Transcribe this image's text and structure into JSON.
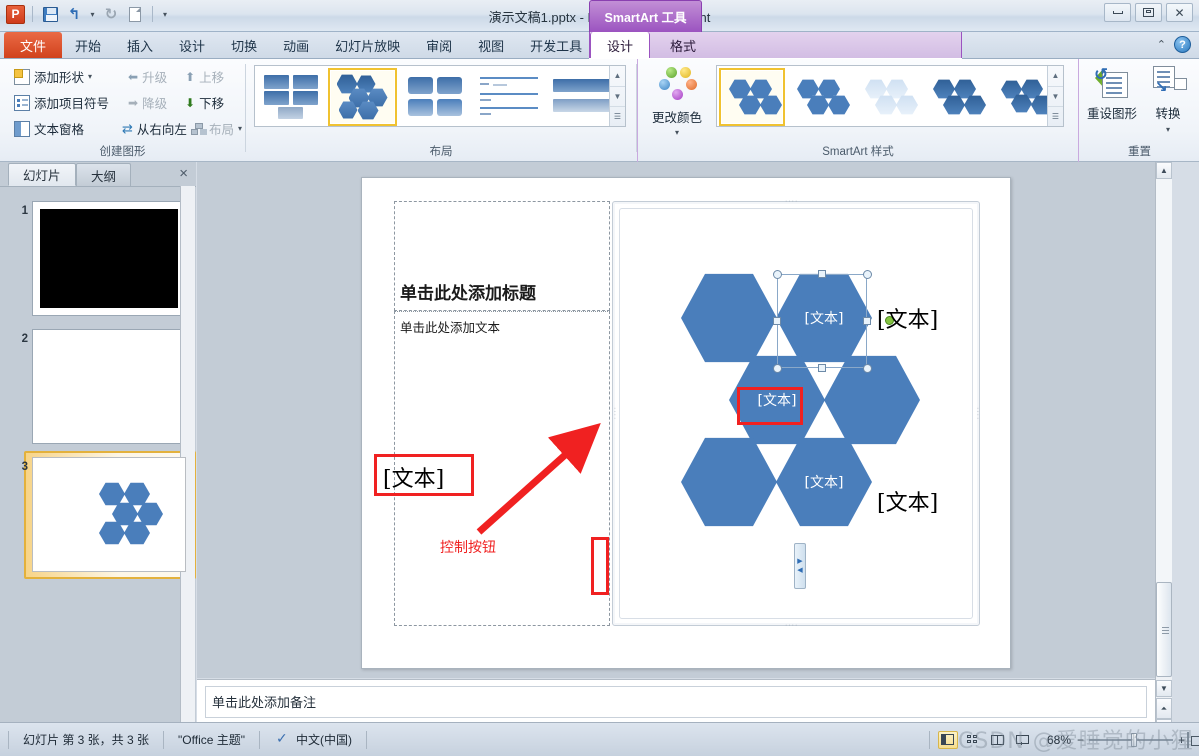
{
  "window": {
    "title": "演示文稿1.pptx  -  Microsoft PowerPoint",
    "minimize": "最小化",
    "restore": "向下还原",
    "close": "关闭"
  },
  "quick_access": {
    "logo": "P",
    "save": "保存",
    "undo": "撤消",
    "redo": "重复",
    "new": "新建",
    "customize": "自定义快速访问工具栏"
  },
  "tabs": [
    {
      "label": "文件",
      "type": "file"
    },
    {
      "label": "开始"
    },
    {
      "label": "插入"
    },
    {
      "label": "设计"
    },
    {
      "label": "切换"
    },
    {
      "label": "动画"
    },
    {
      "label": "幻灯片放映"
    },
    {
      "label": "审阅"
    },
    {
      "label": "视图"
    },
    {
      "label": "开发工具"
    }
  ],
  "contextual": {
    "banner": "SmartArt 工具",
    "tabs": [
      {
        "label": "设计",
        "selected": true
      },
      {
        "label": "格式",
        "selected": false
      }
    ]
  },
  "ribbon": {
    "groups": [
      {
        "name": "创建图形",
        "items": [
          {
            "label": "添加形状",
            "dropdown": true,
            "enabled": true
          },
          {
            "label": "升级",
            "enabled": false
          },
          {
            "label": "上移",
            "enabled": false
          },
          {
            "label": "添加项目符号",
            "enabled": true
          },
          {
            "label": "降级",
            "enabled": false
          },
          {
            "label": "下移",
            "enabled": true
          },
          {
            "label": "文本窗格",
            "enabled": true
          },
          {
            "label": "从右向左",
            "enabled": true
          },
          {
            "label": "布局",
            "dropdown": true,
            "enabled": false
          }
        ]
      },
      {
        "name": "布局"
      },
      {
        "name": "SmartArt 样式",
        "change_colors": "更改颜色"
      },
      {
        "name": "重置",
        "items": [
          {
            "label": "重设图形"
          },
          {
            "label": "转换"
          }
        ]
      }
    ],
    "layout_gallery": [
      {
        "name": "layout-thumb-blocks",
        "selected": false
      },
      {
        "name": "layout-thumb-hexagon",
        "selected": true
      },
      {
        "name": "layout-thumb-rounded",
        "selected": false
      },
      {
        "name": "layout-thumb-lines",
        "selected": false
      },
      {
        "name": "layout-thumb-bars",
        "selected": false
      }
    ],
    "style_gallery": [
      {
        "name": "style-thumb-simple-fill",
        "selected": true
      },
      {
        "name": "style-thumb-white-outline",
        "selected": false
      },
      {
        "name": "style-thumb-subtle-effect",
        "selected": false
      },
      {
        "name": "style-thumb-moderate-effect",
        "selected": false
      },
      {
        "name": "style-thumb-intense-effect",
        "selected": false
      }
    ],
    "scroll": {
      "up": "▲",
      "down": "▼",
      "more": "▼"
    }
  },
  "slides_panel": {
    "tabs": [
      {
        "label": "幻灯片",
        "selected": true
      },
      {
        "label": "大纲",
        "selected": false
      }
    ],
    "close": "×",
    "slides": [
      {
        "number": "1",
        "selected": false,
        "content": "black"
      },
      {
        "number": "2",
        "selected": false,
        "content": "blank"
      },
      {
        "number": "3",
        "selected": true,
        "content": "hexagons"
      }
    ]
  },
  "slide": {
    "title_placeholder": "单击此处添加标题",
    "body_placeholder": "单击此处添加文本",
    "smartart": {
      "hexagons": [
        {
          "id": "hex-top-left",
          "label": ""
        },
        {
          "id": "hex-top-middle",
          "label": "[文本]",
          "selected": true
        },
        {
          "id": "hex-mid-left",
          "label": "[文本]",
          "highlighted": true
        },
        {
          "id": "hex-mid-right",
          "label": ""
        },
        {
          "id": "hex-bottom-left",
          "label": ""
        },
        {
          "id": "hex-bottom-middle",
          "label": "[文本]"
        }
      ],
      "outside_labels": [
        {
          "id": "outside-label-left",
          "text": "[文本]",
          "highlighted": true
        },
        {
          "id": "outside-label-top-right",
          "text": "[文本]"
        },
        {
          "id": "outside-label-bottom-right",
          "text": "[文本]"
        }
      ]
    }
  },
  "annotation": {
    "label": "控制按钮",
    "color": "#f02121"
  },
  "control_button": {
    "expand": "▶",
    "collapse": "◀"
  },
  "notes": {
    "placeholder": "单击此处添加备注"
  },
  "status_bar": {
    "slide_info": "幻灯片 第 3 张，共 3 张",
    "theme": "\"Office 主题\"",
    "language": "中文(中国)",
    "zoom": "68%",
    "views": [
      {
        "name": "view-normal",
        "selected": true
      },
      {
        "name": "view-slide-sorter",
        "selected": false
      },
      {
        "name": "view-reading",
        "selected": false
      },
      {
        "name": "view-slide-show",
        "selected": false
      }
    ],
    "zoom_out": "−",
    "zoom_in": "+"
  },
  "watermark": {
    "text": "CSDN @爱睡觉的小猩"
  },
  "colors": {
    "hexagon_fill": "#4a7ebb",
    "annotation_red": "#f02121",
    "contextual_purple": "#9b53c0",
    "selection_gold": "#f0c230",
    "file_tab_orange": "#d1421d"
  }
}
